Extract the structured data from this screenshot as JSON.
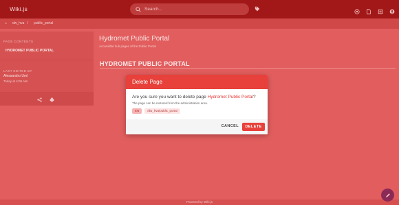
{
  "app": {
    "title": "Wiki.js"
  },
  "search": {
    "placeholder": "Search..."
  },
  "breadcrumb": {
    "items": [
      "dw_hva",
      "public_portal"
    ]
  },
  "sidebar": {
    "contents_heading": "PAGE CONTENTS",
    "contents_item": "HYDROMET PUBLIC PORTAL",
    "edited_heading": "LAST EDITED BY",
    "edited_by": "Alessandro Uml",
    "edited_when": "Today at 4:00 AM"
  },
  "page": {
    "title": "Hydromet Public Portal",
    "subtitle": "Accessible hub pages of the Public Portal",
    "heading": "HYDROMET PUBLIC PORTAL"
  },
  "dialog": {
    "title": "Delete Page",
    "question_prefix": "Are you sure you want to delete page ",
    "page_name": "Hydromet Public Portal",
    "question_suffix": "?",
    "note": "The page can be restored from the administration area.",
    "locale": "EN",
    "path": "/dw_hva/public_portal",
    "cancel_label": "CANCEL",
    "delete_label": "DELETE"
  },
  "footer": {
    "text": "Powered by Wiki.js"
  },
  "colors": {
    "accent": "#e8403a",
    "appbar": "#a21818",
    "overlay": "#e25e5e",
    "fab": "#8b2a56"
  }
}
